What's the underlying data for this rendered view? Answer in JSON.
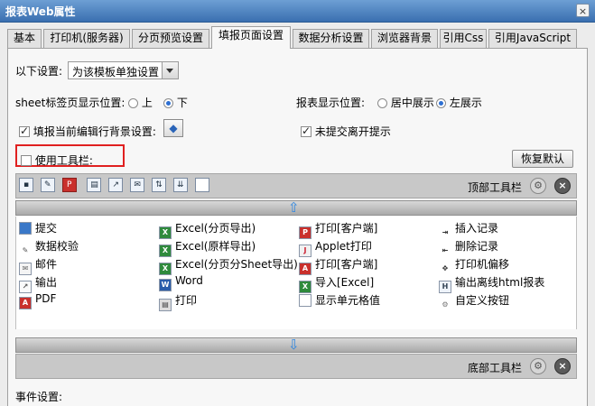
{
  "window": {
    "title": "报表Web属性",
    "close_icon": "×"
  },
  "tabs": [
    {
      "label": "基本"
    },
    {
      "label": "打印机(服务器)"
    },
    {
      "label": "分页预览设置"
    },
    {
      "label": "填报页面设置",
      "active": true
    },
    {
      "label": "数据分析设置"
    },
    {
      "label": "浏览器背景"
    },
    {
      "label": "引用Css"
    },
    {
      "label": "引用JavaScript"
    }
  ],
  "settings": {
    "mode_label": "以下设置:",
    "mode_value": "为该模板单独设置",
    "sheet_pos_label": "sheet标签页显示位置:",
    "sheet_top": "上",
    "sheet_bottom": "下",
    "report_pos_label": "报表显示位置:",
    "report_center": "居中展示",
    "report_left": "左展示",
    "edit_row_bg_label": "填报当前编辑行背景设置:",
    "unsubmitted_label": "未提交离开提示",
    "use_toolbar_label": "使用工具栏:",
    "restore_default": "恢复默认"
  },
  "top_toolbar": {
    "label": "顶部工具栏"
  },
  "bottom_toolbar": {
    "label": "底部工具栏"
  },
  "toolbar_items": [
    {
      "label": "提交",
      "icon": "save-icon"
    },
    {
      "label": "Excel(分页导出)",
      "icon": "excel-icon"
    },
    {
      "label": "打印[客户端]",
      "icon": "pdf-print-icon"
    },
    {
      "label": "插入记录",
      "icon": "insert-record-icon"
    },
    {
      "label": "数据校验",
      "icon": "validate-icon"
    },
    {
      "label": "Excel(原样导出)",
      "icon": "excel-icon"
    },
    {
      "label": "Applet打印",
      "icon": "applet-icon"
    },
    {
      "label": "删除记录",
      "icon": "delete-record-icon"
    },
    {
      "label": "邮件",
      "icon": "mail-icon"
    },
    {
      "label": "Excel(分页分Sheet导出)",
      "icon": "excel-icon"
    },
    {
      "label": "打印[客户端]",
      "icon": "acrobat-icon"
    },
    {
      "label": "打印机偏移",
      "icon": "move-icon"
    },
    {
      "label": "输出",
      "icon": "export-icon"
    },
    {
      "label": "Word",
      "icon": "word-icon"
    },
    {
      "label": "导入[Excel]",
      "icon": "excel-icon"
    },
    {
      "label": "输出离线html报表",
      "icon": "html-report-icon"
    },
    {
      "label": "PDF",
      "icon": "pdf-icon"
    },
    {
      "label": "打印",
      "icon": "printer-icon"
    },
    {
      "label": "显示单元格值",
      "icon": "cell-icon"
    },
    {
      "label": "自定义按钮",
      "icon": "gear-icon"
    }
  ],
  "events": {
    "label": "事件设置:"
  }
}
